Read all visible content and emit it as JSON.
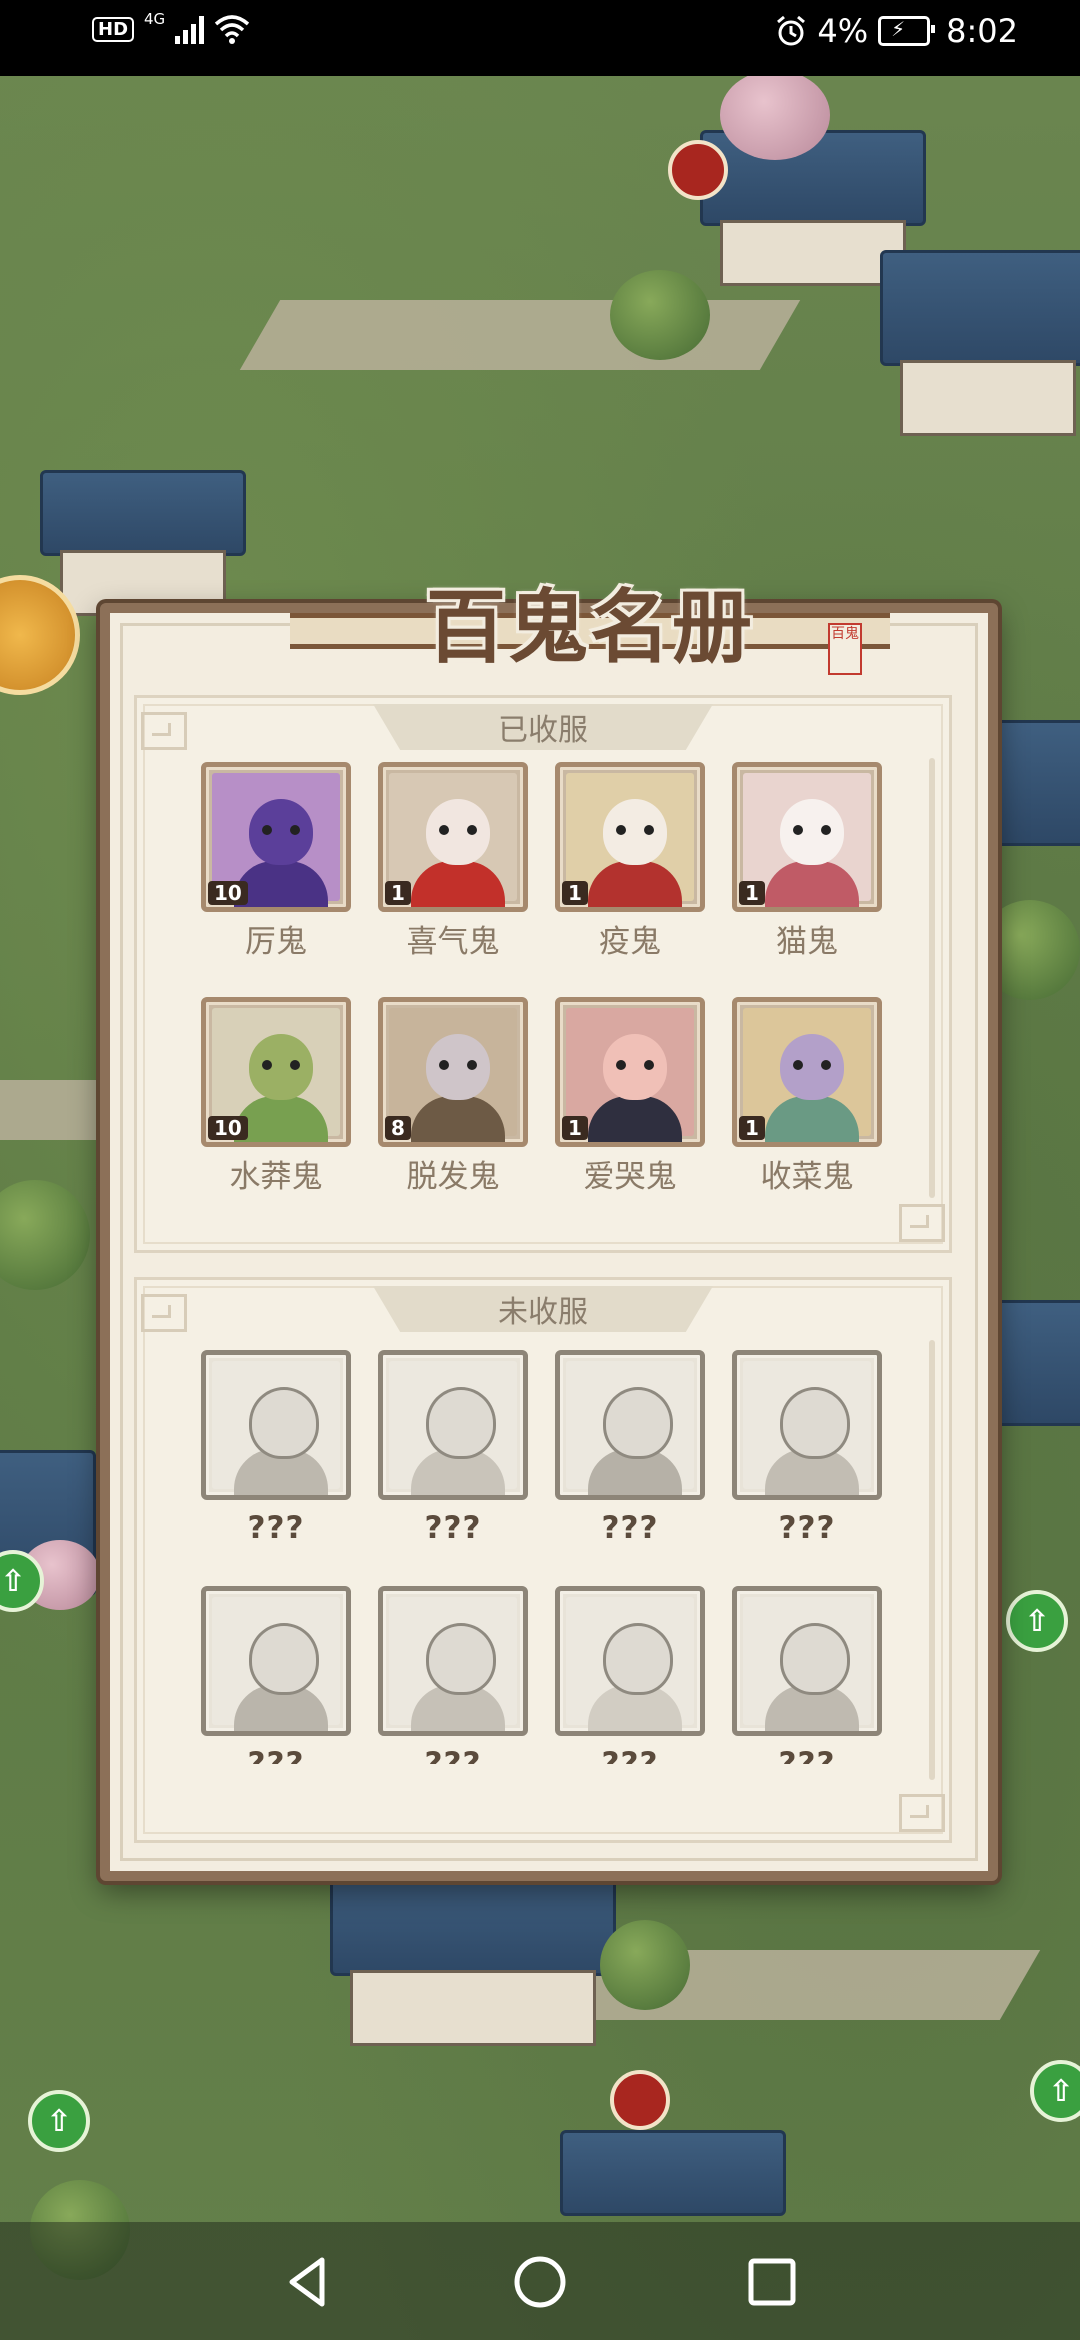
{
  "status_bar": {
    "hd": "HD",
    "network": "4G",
    "battery_percent": "4%",
    "time": "8:02"
  },
  "registry": {
    "title": "百鬼名册",
    "seal_text": "百鬼",
    "collected": {
      "header": "已收服",
      "items": [
        {
          "name": "厉鬼",
          "count": "10",
          "palette": {
            "bg": "#b78fc7",
            "head": "#5b3f9a",
            "body": "#4a3285"
          }
        },
        {
          "name": "喜气鬼",
          "count": "1",
          "palette": {
            "bg": "#d7c8b4",
            "head": "#f1e6e0",
            "body": "#c2302a"
          }
        },
        {
          "name": "疫鬼",
          "count": "1",
          "palette": {
            "bg": "#e0cfa8",
            "head": "#f3ece3",
            "body": "#b3322e"
          }
        },
        {
          "name": "猫鬼",
          "count": "1",
          "palette": {
            "bg": "#e9d4cf",
            "head": "#f7f1ee",
            "body": "#c05b66"
          }
        },
        {
          "name": "水莽鬼",
          "count": "10",
          "palette": {
            "bg": "#d8d0b8",
            "head": "#9bb064",
            "body": "#78a050"
          }
        },
        {
          "name": "脱发鬼",
          "count": "8",
          "palette": {
            "bg": "#c7b49b",
            "head": "#cfc5c9",
            "body": "#6d5a45"
          }
        },
        {
          "name": "爱哭鬼",
          "count": "1",
          "palette": {
            "bg": "#d9a8a1",
            "head": "#f0c0b7",
            "body": "#2f2f3f"
          }
        },
        {
          "name": "收菜鬼",
          "count": "1",
          "palette": {
            "bg": "#dcc69a",
            "head": "#b3a0c9",
            "body": "#6a9a84"
          }
        }
      ]
    },
    "uncollected": {
      "header": "未收服",
      "items": [
        {
          "name": "???"
        },
        {
          "name": "???"
        },
        {
          "name": "???"
        },
        {
          "name": "???"
        },
        {
          "name": "???"
        },
        {
          "name": "???"
        },
        {
          "name": "???"
        },
        {
          "name": "???"
        }
      ]
    }
  }
}
